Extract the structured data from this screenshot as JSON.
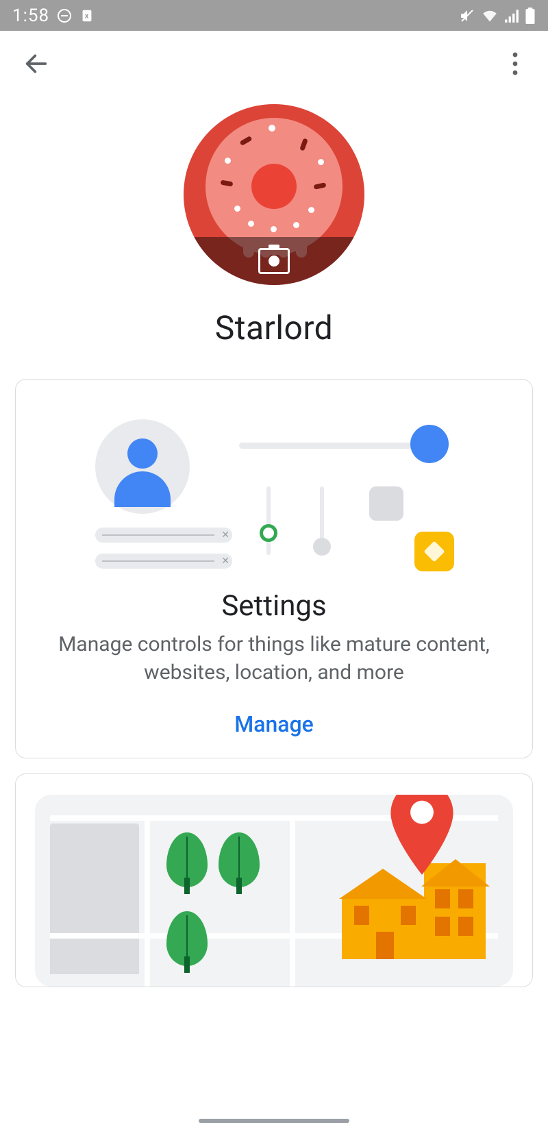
{
  "status": {
    "time": "1:58",
    "icons": {
      "dnd": "dnd-icon",
      "doc": "doc-icon",
      "mute": "mute-icon",
      "wifi": "wifi-icon",
      "signal": "signal-icon",
      "battery": "battery-icon"
    }
  },
  "nav": {
    "back": "back-icon",
    "more": "more-icon"
  },
  "profile": {
    "name": "Starlord",
    "avatar_colors": {
      "bg": "#db4437",
      "donut": "#f28b82",
      "center": "#ea4335"
    },
    "camera_action": "change-photo"
  },
  "cards": {
    "settings": {
      "title": "Settings",
      "description": "Manage controls for things like mature content, websites, location, and more",
      "action_label": "Manage"
    },
    "location": {
      "illustration": "map-location"
    }
  }
}
